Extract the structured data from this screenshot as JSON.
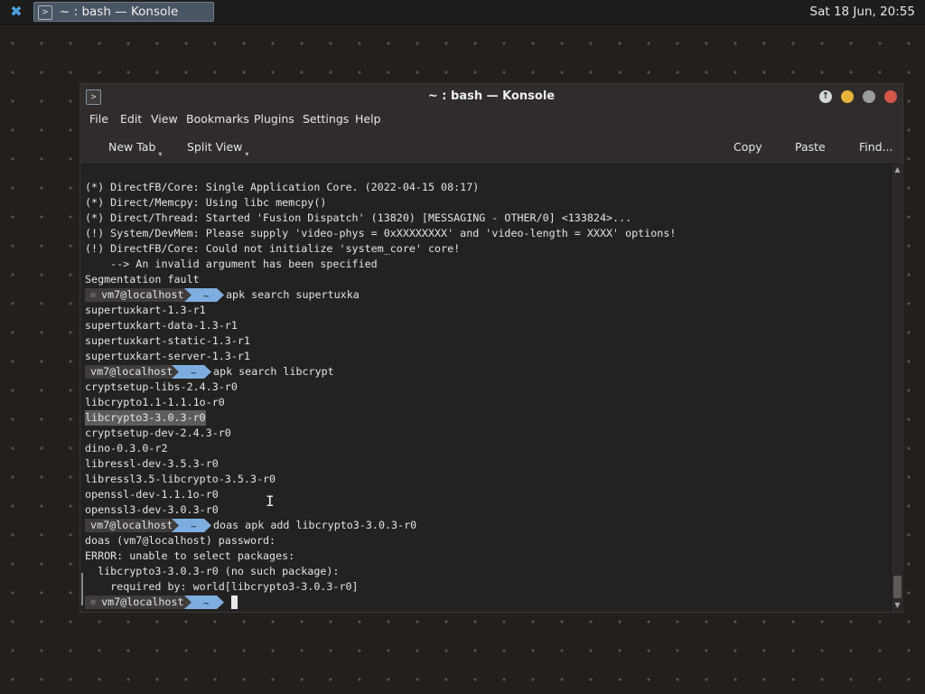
{
  "panel": {
    "task_title": "~ : bash — Konsole",
    "clock": "Sat 18 Jun, 20:55"
  },
  "window": {
    "title": "~ : bash — Konsole"
  },
  "menu": [
    "File",
    "Edit",
    "View",
    "Bookmarks",
    "Plugins",
    "Settings",
    "Help"
  ],
  "toolbar": {
    "new_tab": "New Tab",
    "split_view": "Split View",
    "copy": "Copy",
    "paste": "Paste",
    "find": "Find..."
  },
  "terminal": {
    "prompt_user": "vm7@localhost",
    "prompt_dir": "~",
    "lines": [
      "(*) DirectFB/Core: Single Application Core. (2022-04-15 08:17)",
      "(*) Direct/Memcpy: Using libc memcpy()",
      "(*) Direct/Thread: Started 'Fusion Dispatch' (13820) [MESSAGING - OTHER/0] <133824>...",
      "(!) System/DevMem: Please supply 'video-phys = 0xXXXXXXXX' and 'video-length = XXXX' options!",
      "(!) DirectFB/Core: Could not initialize 'system_core' core!",
      "    --> An invalid argument has been specified",
      "Segmentation fault",
      "supertuxkart-1.3-r1",
      "supertuxkart-data-1.3-r1",
      "supertuxkart-static-1.3-r1",
      "supertuxkart-server-1.3-r1",
      "cryptsetup-libs-2.4.3-r0",
      "libcrypto1.1-1.1.1o-r0",
      "libcrypto3-3.0.3-r0",
      "cryptsetup-dev-2.4.3-r0",
      "dino-0.3.0-r2",
      "libressl-dev-3.5.3-r0",
      "libressl3.5-libcrypto-3.5.3-r0",
      "openssl-dev-1.1.1o-r0",
      "openssl3-dev-3.0.3-r0",
      "doas (vm7@localhost) password:",
      "ERROR: unable to select packages:",
      "  libcrypto3-3.0.3-r0 (no such package):",
      "    required by: world[libcrypto3-3.0.3-r0]"
    ],
    "commands": [
      "apk search supertuxka",
      "apk search libcrypt",
      "doas apk add libcrypto3-3.0.3-r0"
    ]
  }
}
